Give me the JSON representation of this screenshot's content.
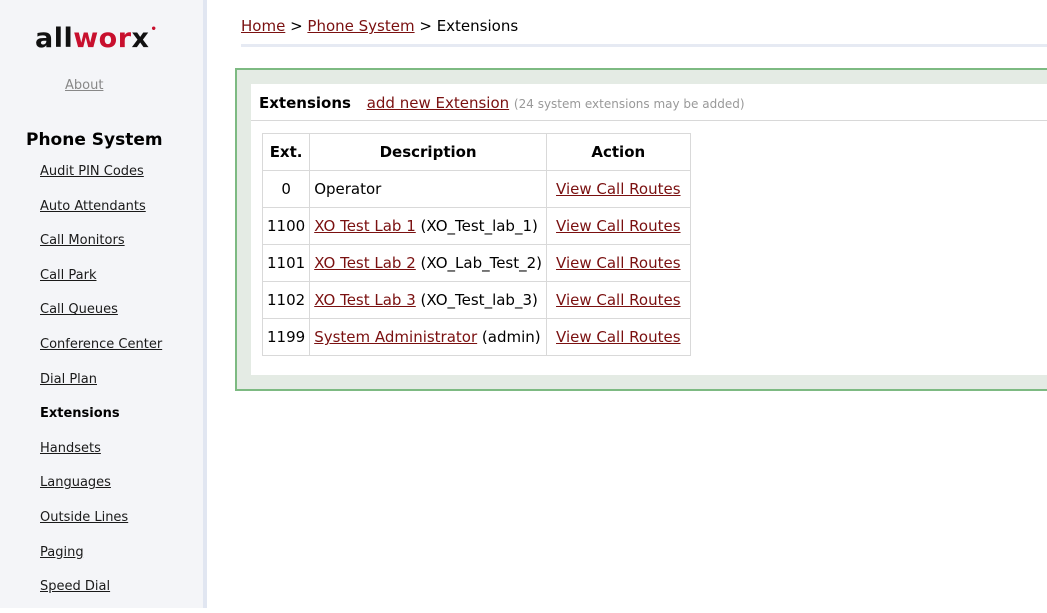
{
  "brand": {
    "logo_pre": "all",
    "logo_w": "wor",
    "logo_post": "x",
    "logo_dot": "•"
  },
  "sidebar": {
    "about": "About",
    "heading": "Phone System",
    "items": [
      {
        "label": "Audit PIN Codes"
      },
      {
        "label": "Auto Attendants"
      },
      {
        "label": "Call Monitors"
      },
      {
        "label": "Call Park"
      },
      {
        "label": "Call Queues"
      },
      {
        "label": "Conference Center"
      },
      {
        "label": "Dial Plan"
      },
      {
        "label": "Extensions",
        "current": true
      },
      {
        "label": "Handsets"
      },
      {
        "label": "Languages"
      },
      {
        "label": "Outside Lines"
      },
      {
        "label": "Paging"
      },
      {
        "label": "Speed Dial"
      }
    ]
  },
  "breadcrumb": {
    "home": "Home",
    "sep1": " > ",
    "phone_system": "Phone System",
    "sep2": " > ",
    "current": "Extensions"
  },
  "panel": {
    "title": "Extensions",
    "add_link": "add new Extension",
    "note": "(24 system extensions may be added)"
  },
  "table": {
    "headers": {
      "ext": "Ext.",
      "description": "Description",
      "action": "Action"
    },
    "rows": [
      {
        "ext": "0",
        "name": "Operator",
        "name_link": false,
        "suffix": "",
        "action": "View Call Routes"
      },
      {
        "ext": "1100",
        "name": "XO Test Lab 1",
        "name_link": true,
        "suffix": " (XO_Test_lab_1)",
        "action": "View Call Routes"
      },
      {
        "ext": "1101",
        "name": "XO Test Lab 2",
        "name_link": true,
        "suffix": " (XO_Lab_Test_2)",
        "action": "View Call Routes"
      },
      {
        "ext": "1102",
        "name": "XO Test Lab 3",
        "name_link": true,
        "suffix": " (XO_Test_lab_3)",
        "action": "View Call Routes"
      },
      {
        "ext": "1199",
        "name": "System Administrator",
        "name_link": true,
        "suffix": " (admin)",
        "action": "View Call Routes"
      }
    ]
  },
  "colors": {
    "link": "#7a1010",
    "panel_border": "#7dba82",
    "logo_accent": "#c8102e"
  }
}
